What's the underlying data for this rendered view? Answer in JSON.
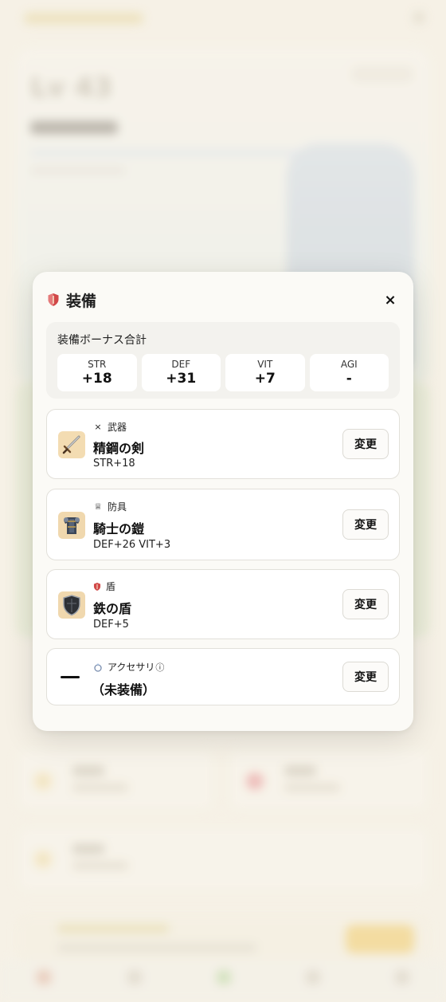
{
  "modal": {
    "title": "装備",
    "close_label": "×"
  },
  "bonus": {
    "title": "装備ボーナス合計",
    "stats": [
      {
        "label": "STR",
        "value": "+18"
      },
      {
        "label": "DEF",
        "value": "+31"
      },
      {
        "label": "VIT",
        "value": "+7"
      },
      {
        "label": "AGI",
        "value": "-"
      }
    ]
  },
  "slots": [
    {
      "category": "武器",
      "category_icon": "×",
      "name": "精鋼の剣",
      "stat": "STR+18",
      "button": "変更",
      "thumb_icon": "sword-icon"
    },
    {
      "category": "防具",
      "category_icon": "♕",
      "name": "騎士の鎧",
      "stat": "DEF+26 VIT+3",
      "button": "変更",
      "thumb_icon": "armor-icon"
    },
    {
      "category": "盾",
      "category_icon": "shield",
      "name": "鉄の盾",
      "stat": "DEF+5",
      "button": "変更",
      "thumb_icon": "iron-shield-icon"
    },
    {
      "category": "アクセサリ",
      "category_icon": "ring",
      "info_icon": "ⓘ",
      "name": "（未装備）",
      "stat": "",
      "button": "変更",
      "thumb_icon": "empty-dash-icon"
    }
  ],
  "colors": {
    "background": "#f4efe3",
    "modal": "#fbfaf6",
    "accent_red": "#c73a3a"
  }
}
